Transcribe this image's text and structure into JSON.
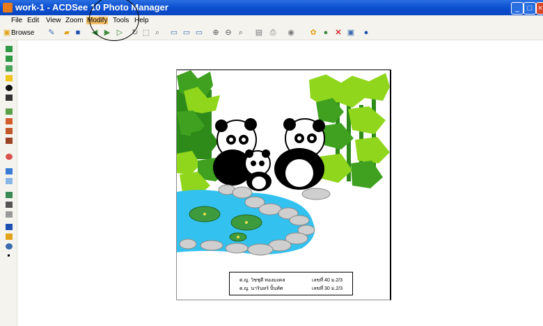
{
  "window": {
    "title": "work-1 - ACDSee 10 Photo Manager"
  },
  "menu": {
    "items": [
      "File",
      "Edit",
      "View",
      "Zoom",
      "Modify",
      "Tools",
      "Help"
    ],
    "active": "Modify"
  },
  "toolbar": {
    "browse_label": "Browse"
  },
  "caption": {
    "line1_name": "ด.ญ. วิชชุดี  ทองมงคล",
    "line1_num": "เลขที่ 40 ม.2/3",
    "line2_name": "ด.ญ. นารินทร์  ปั้นทัศ",
    "line2_num": "เลขที่ 30 ม.2/3"
  },
  "colors": {
    "titlebar": "#0a4fd0",
    "pond": "#33c2f0",
    "bamboo": "#2e8b1a",
    "leaf_light": "#8fd61c"
  }
}
